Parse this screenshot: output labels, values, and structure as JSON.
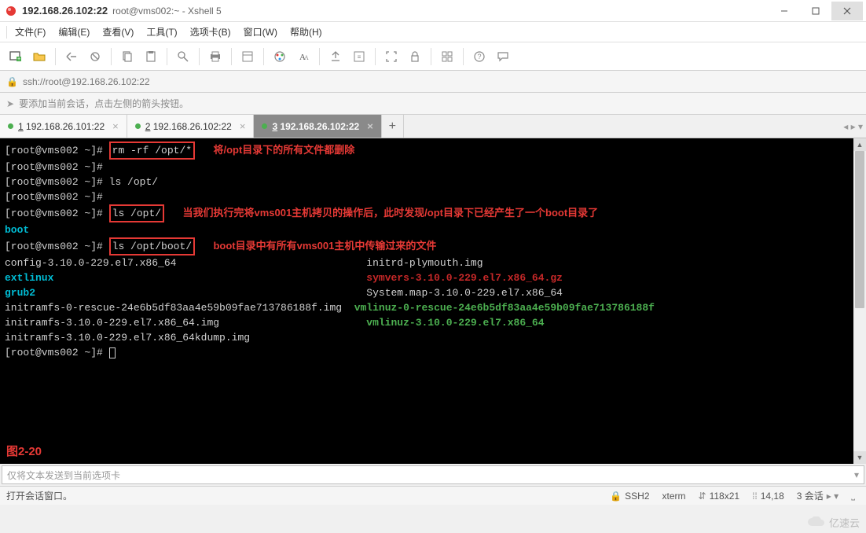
{
  "window": {
    "title": "192.168.26.102:22",
    "subtitle": "root@vms002:~ - Xshell 5"
  },
  "menu": {
    "file": "文件(F)",
    "edit": "编辑(E)",
    "view": "查看(V)",
    "tools": "工具(T)",
    "tab": "选项卡(B)",
    "window": "窗口(W)",
    "help": "帮助(H)"
  },
  "address": {
    "url": "ssh://root@192.168.26.102:22"
  },
  "hint": {
    "text": "要添加当前会话，点击左侧的箭头按钮。"
  },
  "tabs": [
    {
      "num": "1",
      "label": " 192.168.26.101:22"
    },
    {
      "num": "2",
      "label": " 192.168.26.102:22"
    },
    {
      "num": "3",
      "label": " 192.168.26.102:22"
    }
  ],
  "terminal": {
    "prompt": "[root@vms002 ~]#",
    "cmd1": "rm -rf /opt/*",
    "annot1": "将/opt目录下的所有文件都删除",
    "cmd2": "ls /opt/",
    "cmd3": "ls /opt/",
    "annot2": "当我们执行完将vms001主机拷贝的操作后，此时发现/opt目录下已经产生了一个boot目录了",
    "boot": "boot",
    "cmd4": "ls /opt/boot/",
    "annot3": "boot目录中有所有vms001主机中传输过来的文件",
    "l1a": "config-3.10.0-229.el7.x86_64",
    "l1b": "initrd-plymouth.img",
    "l2a": "extlinux",
    "l2b": "symvers-3.10.0-229.el7.x86_64.gz",
    "l3a": "grub2",
    "l3b": "System.map-3.10.0-229.el7.x86_64",
    "l4a": "initramfs-0-rescue-24e6b5df83aa4e59b09fae713786188f.img",
    "l4b": "vmlinuz-0-rescue-24e6b5df83aa4e59b09fae713786188f",
    "l5a": "initramfs-3.10.0-229.el7.x86_64.img",
    "l5b": "vmlinuz-3.10.0-229.el7.x86_64",
    "l6a": "initramfs-3.10.0-229.el7.x86_64kdump.img",
    "figlabel": "图2-20"
  },
  "inputbar": {
    "placeholder": "仅将文本发送到当前选项卡"
  },
  "status": {
    "msg": "打开会话窗口。",
    "ssh": "SSH2",
    "term": "xterm",
    "size": "118x21",
    "pos": "14,18",
    "sessions": "3 会话",
    "sizeicon": "⇵",
    "posicon": "⁞⁞"
  },
  "watermark": {
    "text": "亿速云"
  }
}
